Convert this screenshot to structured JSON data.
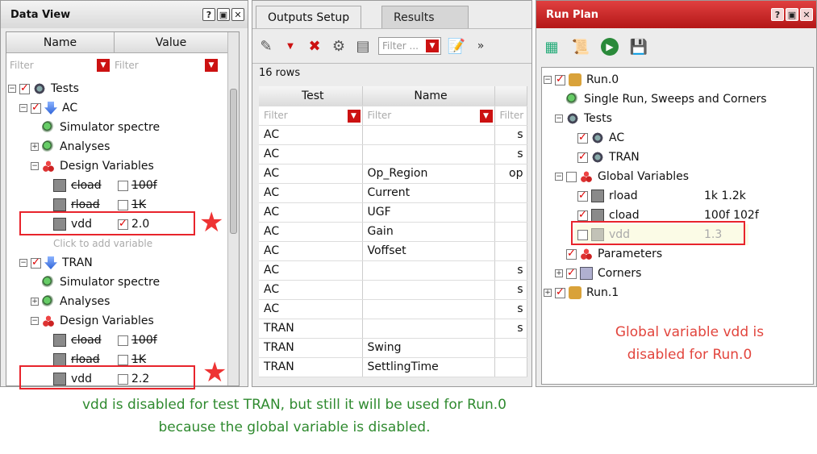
{
  "data_view": {
    "title": "Data View",
    "col_name": "Name",
    "col_value": "Value",
    "filter": "Filter",
    "rows": {
      "tests": "Tests",
      "ac": "AC",
      "sim1": "Simulator  spectre",
      "an1": "Analyses",
      "dv1": "Design Variables",
      "cload1": "cload",
      "cload1_val": "100f",
      "rload1": "rload",
      "rload1_val": "1K",
      "vdd1": "vdd",
      "vdd1_val": "2.0",
      "click_add": "Click to add variable",
      "tran": "TRAN",
      "sim2": "Simulator  spectre",
      "an2": "Analyses",
      "dv2": "Design Variables",
      "cload2": "cload",
      "cload2_val": "100f",
      "rload2": "rload",
      "rload2_val": "1K",
      "vdd2": "vdd",
      "vdd2_val": "2.2"
    }
  },
  "outputs": {
    "tab_active": "Outputs Setup",
    "tab_other": "Results",
    "filter_placeholder": "Filter ...",
    "row_count": "16 rows",
    "col_test": "Test",
    "col_name": "Name",
    "filter": "Filter",
    "rows": [
      {
        "test": "AC",
        "name": "",
        "t": "s"
      },
      {
        "test": "AC",
        "name": "",
        "t": "s"
      },
      {
        "test": "AC",
        "name": "Op_Region",
        "t": "op"
      },
      {
        "test": "AC",
        "name": "Current",
        "t": ""
      },
      {
        "test": "AC",
        "name": "UGF",
        "t": ""
      },
      {
        "test": "AC",
        "name": "Gain",
        "t": ""
      },
      {
        "test": "AC",
        "name": "Voffset",
        "t": ""
      },
      {
        "test": "AC",
        "name": "",
        "t": "s"
      },
      {
        "test": "AC",
        "name": "",
        "t": "s"
      },
      {
        "test": "AC",
        "name": "",
        "t": "s"
      },
      {
        "test": "TRAN",
        "name": "",
        "t": "s"
      },
      {
        "test": "TRAN",
        "name": "Swing",
        "t": ""
      },
      {
        "test": "TRAN",
        "name": "SettlingTime",
        "t": ""
      }
    ]
  },
  "run_plan": {
    "title": "Run Plan",
    "run0": "Run.0",
    "single_run": "Single Run, Sweeps and Corners",
    "tests": "Tests",
    "ac": "AC",
    "tran": "TRAN",
    "global_vars": "Global Variables",
    "rload": "rload",
    "rload_val": "1k 1.2k",
    "cload": "cload",
    "cload_val": "100f 102f",
    "vdd": "vdd",
    "vdd_val": "1.3",
    "parameters": "Parameters",
    "corners": "Corners",
    "run1": "Run.1"
  },
  "annotations": {
    "right": "Global variable vdd is disabled for Run.0",
    "bottom_line1": "vdd is disabled for test TRAN, but still it will be used for Run.0",
    "bottom_line2": "because the global variable is disabled."
  }
}
